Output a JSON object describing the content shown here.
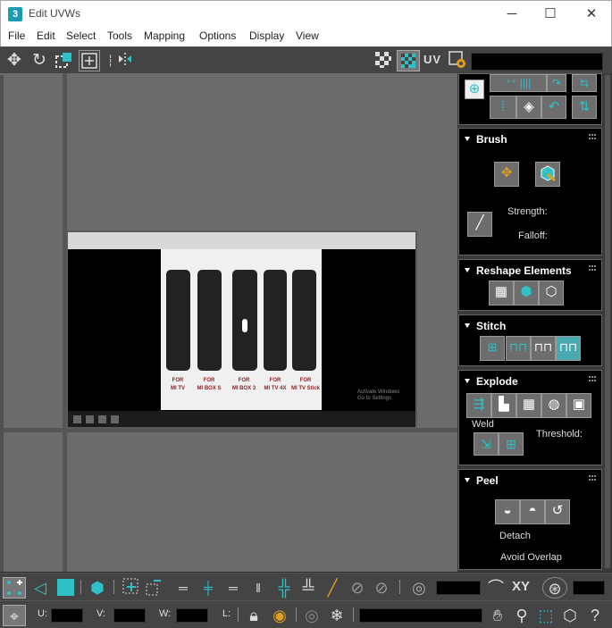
{
  "window": {
    "icon_text": "3",
    "title": "Edit UVWs",
    "minimize": "─",
    "maximize": "☐",
    "close": "✕"
  },
  "menu": [
    "File",
    "Edit",
    "Select",
    "Tools",
    "Mapping",
    "Options",
    "Display",
    "View"
  ],
  "toolbar": {
    "uv_label": "UV"
  },
  "texture": {
    "captions": [
      [
        "FOR",
        "MI TV"
      ],
      [
        "FOR",
        "MI BOX S"
      ],
      [
        "FOR",
        "MI BOX 3"
      ],
      [
        "FOR",
        "MI TV 4X"
      ],
      [
        "FOR",
        "MI TV Stick"
      ]
    ],
    "watermark": [
      "Activate Windows",
      "Go to Settings"
    ]
  },
  "panel": {
    "brush": {
      "title": "Brush",
      "strength_label": "Strength:",
      "falloff_label": "Falloff:"
    },
    "reshape": {
      "title": "Reshape Elements"
    },
    "stitch": {
      "title": "Stitch"
    },
    "explode": {
      "title": "Explode",
      "weld_label": "Weld",
      "threshold_label": "Threshold:"
    },
    "peel": {
      "title": "Peel",
      "detach_label": "Detach",
      "avoid_overlap_label": "Avoid Overlap"
    }
  },
  "status": {
    "xy_label": "XY",
    "u_label": "U:",
    "v_label": "V:",
    "w_label": "W:",
    "l_label": "L:"
  },
  "colors": {
    "accent": "#2fc0c8",
    "background": "#6b6b6b",
    "panel": "#000000"
  }
}
